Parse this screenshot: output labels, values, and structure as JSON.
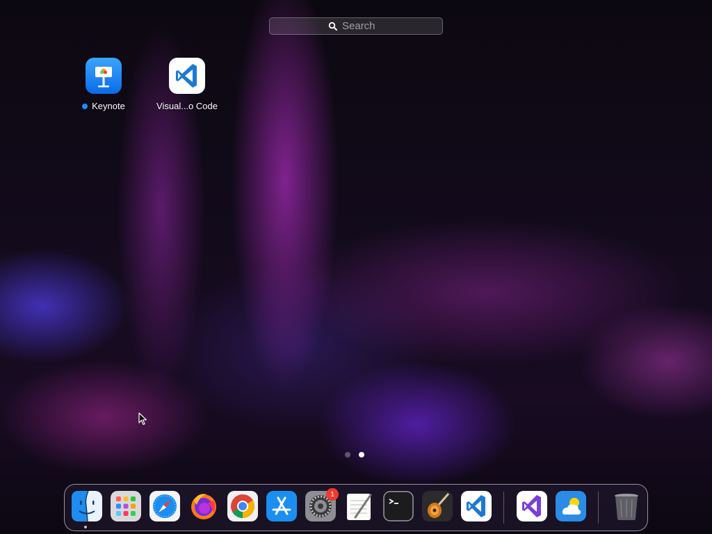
{
  "search": {
    "placeholder": "Search"
  },
  "apps": [
    {
      "label": "Keynote",
      "icon": "keynote-icon",
      "new_dot_color": "#1e8cff"
    },
    {
      "label": "Visual...o Code",
      "icon": "vscode-icon"
    }
  ],
  "pager": {
    "pages": 2,
    "current": 2
  },
  "dock": {
    "items": [
      {
        "icon": "finder-icon",
        "running": true
      },
      {
        "icon": "launchpad-icon"
      },
      {
        "icon": "safari-icon"
      },
      {
        "icon": "firefox-icon"
      },
      {
        "icon": "chrome-icon"
      },
      {
        "icon": "app-store-icon"
      },
      {
        "icon": "system-settings-icon",
        "badge": "1"
      },
      {
        "icon": "textedit-icon"
      },
      {
        "icon": "terminal-icon"
      },
      {
        "icon": "garageband-icon"
      },
      {
        "icon": "vscode-icon"
      },
      {
        "icon": "visual-studio-icon"
      },
      {
        "icon": "weather-icon"
      },
      {
        "icon": "trash-icon"
      }
    ],
    "badge_color": "#f0392f"
  },
  "colors": {
    "accent": "#1e8cff",
    "vscode_blue": "#1c7ad4"
  }
}
